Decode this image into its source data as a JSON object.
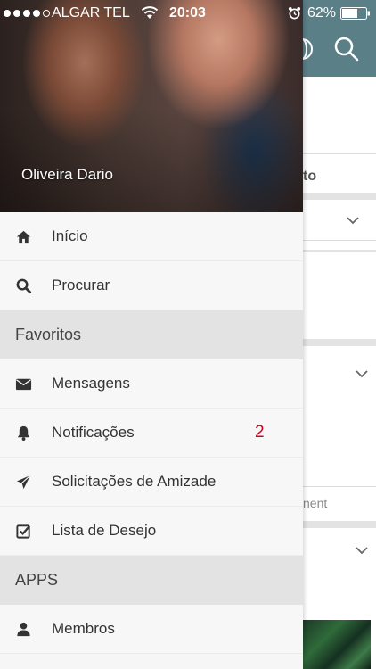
{
  "status_bar": {
    "carrier": "ALGAR TEL",
    "time": "20:03",
    "battery": "62%"
  },
  "profile": {
    "name": "Oliveira Dario"
  },
  "menu": {
    "home": {
      "label": "Início",
      "icon": "home-icon"
    },
    "search": {
      "label": "Procurar",
      "icon": "search-icon"
    },
    "section_favorites": "Favoritos",
    "messages": {
      "label": "Mensagens",
      "icon": "envelope-icon"
    },
    "notifications": {
      "label": "Notificações",
      "icon": "bell-icon",
      "badge": "2"
    },
    "friend_requests": {
      "label": "Solicitações de Amizade",
      "icon": "paper-plane-icon"
    },
    "wishlist": {
      "label": "Lista de Desejo",
      "icon": "checkbox-icon"
    },
    "section_apps": "APPS",
    "members": {
      "label": "Membros",
      "icon": "user-icon"
    }
  },
  "background": {
    "partial_tab_text": "to",
    "partial_action_text": "nent"
  },
  "colors": {
    "topbar": "#5b7f87",
    "badge": "#d0021b",
    "section_bg": "#e3e3e3",
    "drawer_bg": "#f7f7f7"
  }
}
